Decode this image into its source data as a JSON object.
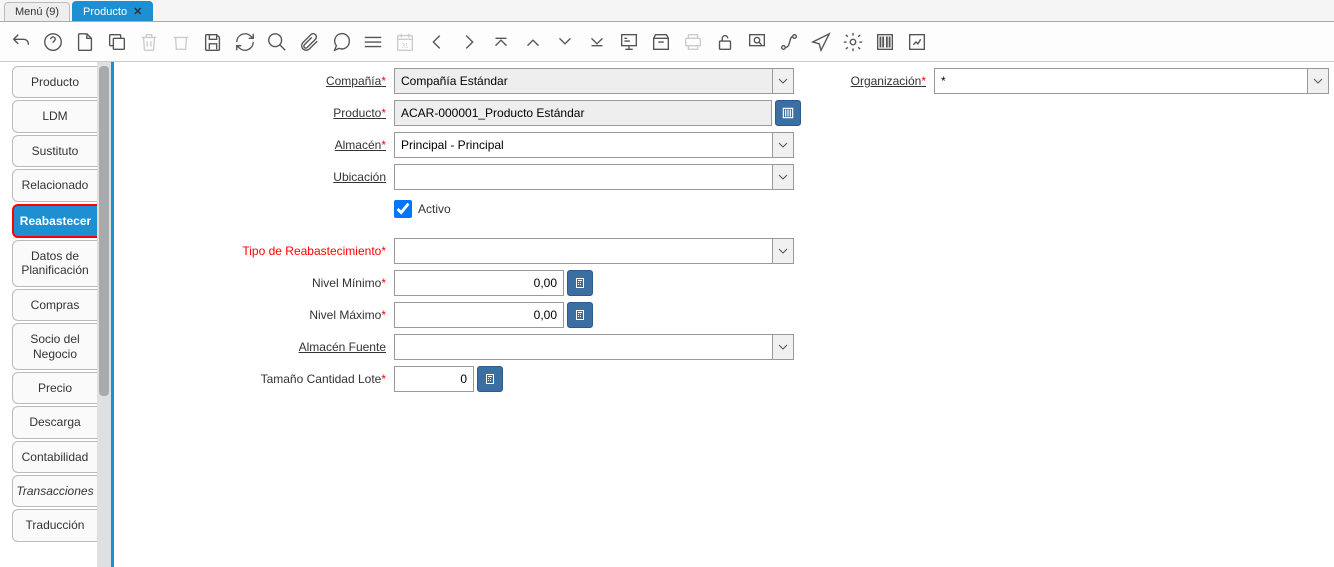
{
  "tabs": {
    "menu": "Menú (9)",
    "producto": "Producto"
  },
  "sidebar": {
    "items": [
      {
        "label": "Producto",
        "selected": false
      },
      {
        "label": "LDM",
        "selected": false
      },
      {
        "label": "Sustituto",
        "selected": false
      },
      {
        "label": "Relacionado",
        "selected": false
      },
      {
        "label": "Reabastecer",
        "selected": true
      },
      {
        "label": "Datos de Planificación",
        "selected": false,
        "twoLine": true
      },
      {
        "label": "Compras",
        "selected": false
      },
      {
        "label": "Socio del Negocio",
        "selected": false,
        "twoLine": true
      },
      {
        "label": "Precio",
        "selected": false
      },
      {
        "label": "Descarga",
        "selected": false
      },
      {
        "label": "Contabilidad",
        "selected": false
      },
      {
        "label": "Transacciones",
        "selected": false,
        "italic": true
      },
      {
        "label": "Traducción",
        "selected": false
      }
    ]
  },
  "form": {
    "compania": {
      "label": "Compañía",
      "value": "Compañía Estándar"
    },
    "organizacion": {
      "label": "Organización",
      "value": "*"
    },
    "producto": {
      "label": "Producto",
      "value": "ACAR-000001_Producto Estándar"
    },
    "almacen": {
      "label": "Almacén",
      "value": "Principal - Principal"
    },
    "ubicacion": {
      "label": "Ubicación",
      "value": ""
    },
    "activo": {
      "label": "Activo",
      "checked": true
    },
    "tipo": {
      "label": "Tipo de Reabastecimiento",
      "value": ""
    },
    "nivelmin": {
      "label": "Nivel Mínimo",
      "value": "0,00"
    },
    "nivelmax": {
      "label": "Nivel Máximo",
      "value": "0,00"
    },
    "almacenfuente": {
      "label": "Almacén Fuente",
      "value": ""
    },
    "lote": {
      "label": "Tamaño Cantidad Lote",
      "value": "0"
    }
  }
}
